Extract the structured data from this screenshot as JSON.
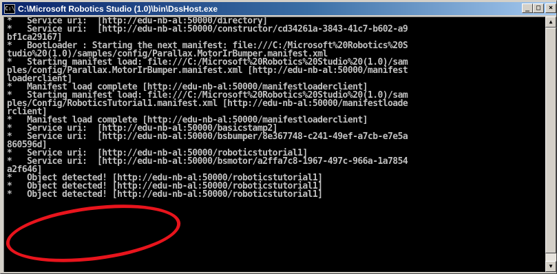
{
  "window": {
    "title": "C:\\Microsoft Robotics Studio (1.0)\\bin\\DssHost.exe",
    "icon": "console-window-icon",
    "icon_label": "C:\\",
    "controls": {
      "minimize": "_",
      "maximize": "□",
      "close": "×"
    }
  },
  "console": {
    "lines": [
      "*   Service uri:  [http://edu-nb-al:50000/directory]",
      "*   Service uri:  [http://edu-nb-al:50000/constructor/cd34261a-3843-41c7-b602-a9",
      "bf1ca29167]",
      "*   BootLoader : Starting the next manifest: file:///C:/Microsoft%20Robotics%20S",
      "tudio%20(1.0)/samples/config/Parallax.MotorIrBumper.manifest.xml",
      "*   Starting manifest load: file:///C:/Microsoft%20Robotics%20Studio%20(1.0)/sam",
      "ples/config/Parallax.MotorIrBumper.manifest.xml [http://edu-nb-al:50000/manifest",
      "loaderclient]",
      "*   Manifest load complete [http://edu-nb-al:50000/manifestloaderclient]",
      "*   Starting manifest load: file:///C:/Microsoft%20Robotics%20Studio%20(1.0)/sam",
      "ples/Config/RoboticsTutorial1.manifest.xml [http://edu-nb-al:50000/manifestloade",
      "rclient]",
      "*   Manifest load complete [http://edu-nb-al:50000/manifestloaderclient]",
      "*   Service uri:  [http://edu-nb-al:50000/basicstamp2]",
      "*   Service uri:  [http://edu-nb-al:50000/bsbumper/8e367748-c241-49ef-a7cb-e7e5a",
      "860596d]",
      "*   Service uri:  [http://edu-nb-al:50000/roboticstutorial1]",
      "*   Service uri:  [http://edu-nb-al:50000/bsmotor/a2ffa7c8-1967-497c-966a-1a7854",
      "a2f646]",
      "*   Object detected! [http://edu-nb-al:50000/roboticstutorial1]",
      "*   Object detected! [http://edu-nb-al:50000/roboticstutorial1]",
      "*   Object detected! [http://edu-nb-al:50000/roboticstutorial1]",
      "",
      "",
      "",
      "",
      "",
      "",
      ""
    ]
  },
  "scrollbar": {
    "up_icon": "up-arrow-icon",
    "down_icon": "down-arrow-icon"
  },
  "colors": {
    "titlebar_start": "#0a246a",
    "titlebar_end": "#a6caf0",
    "console_bg": "#000000",
    "console_text": "#c0c0c0",
    "annotation": "#e8141c"
  }
}
